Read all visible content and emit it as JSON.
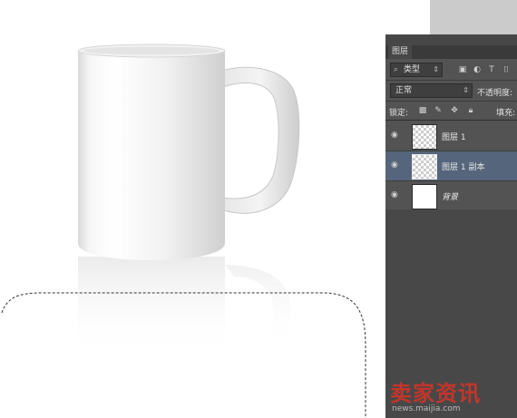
{
  "layers_panel": {
    "tab_label": "图层",
    "filter_kind": "类型",
    "blend_mode": "正常",
    "opacity_label": "不透明度:",
    "lock_label": "锁定:",
    "fill_label": "填充:",
    "icons": [
      "search-icon",
      "image-filter-icon",
      "adjustment-filter-icon",
      "type-filter-icon",
      "shape-filter-icon",
      "lock-transparent-icon",
      "lock-paint-icon",
      "lock-move-icon",
      "lock-all-icon",
      "eye-icon"
    ],
    "layers": [
      {
        "name": "图层 1",
        "visible": true,
        "selected": false,
        "thumb": "transparent"
      },
      {
        "name": "图层 1 副本",
        "visible": true,
        "selected": true,
        "thumb": "transparent"
      },
      {
        "name": "背景",
        "visible": true,
        "selected": false,
        "thumb": "white"
      }
    ],
    "selection_color": "#55657b",
    "panel_color": "#535353"
  },
  "watermark": {
    "text": "卖家资讯",
    "url": "news.maijia.com",
    "color": "#d03428"
  }
}
